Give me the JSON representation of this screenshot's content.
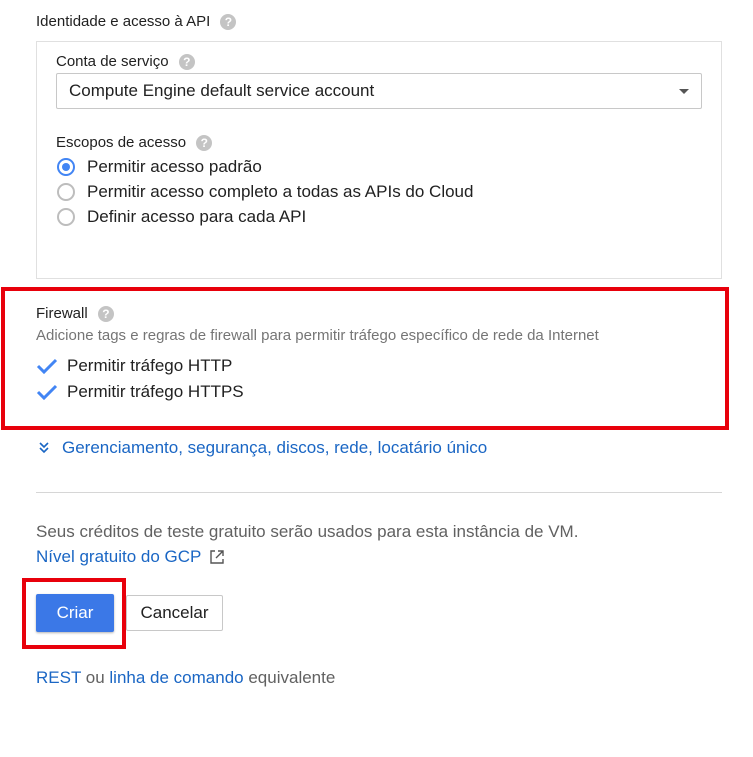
{
  "identity": {
    "title": "Identidade e acesso à API",
    "help": "?",
    "service_account_label": "Conta de serviço",
    "service_account_value": "Compute Engine default service account",
    "scopes_label": "Escopos de acesso",
    "scopes": [
      {
        "label": "Permitir acesso padrão",
        "checked": true
      },
      {
        "label": "Permitir acesso completo a todas as APIs do Cloud",
        "checked": false
      },
      {
        "label": "Definir acesso para cada API",
        "checked": false
      }
    ]
  },
  "firewall": {
    "title": "Firewall",
    "description": "Adicione tags e regras de firewall para permitir tráfego específico de rede da Internet",
    "options": [
      {
        "label": "Permitir tráfego HTTP",
        "checked": true
      },
      {
        "label": "Permitir tráfego HTTPS",
        "checked": true
      }
    ]
  },
  "advanced_link": "Gerenciamento, segurança, discos, rede, locatário único",
  "credits": {
    "text": "Seus créditos de teste gratuito serão usados para esta instância de VM.",
    "link": "Nível gratuito do GCP"
  },
  "actions": {
    "create": "Criar",
    "cancel": "Cancelar"
  },
  "footer": {
    "rest": "REST",
    "or": " ou ",
    "command_line": "linha de comando",
    "equivalent": " equivalente"
  },
  "colors": {
    "accent": "#4285f4",
    "primary_button": "#3b78e7",
    "link": "#1a66c4",
    "highlight": "#e8000b"
  }
}
